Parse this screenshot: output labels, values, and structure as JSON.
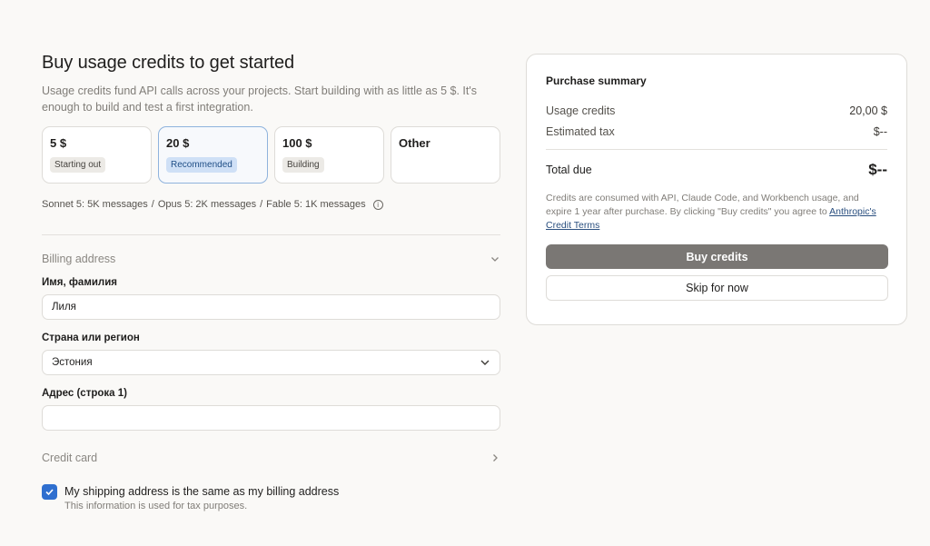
{
  "header": {
    "title": "Buy usage credits to get started",
    "subtitle": "Usage credits fund API calls across your projects. Start building with as little as 5 $. It's enough to build and test a first integration."
  },
  "options": [
    {
      "amount": "5 $",
      "tag": "Starting out",
      "selected": false
    },
    {
      "amount": "20 $",
      "tag": "Recommended",
      "selected": true
    },
    {
      "amount": "100 $",
      "tag": "Building",
      "selected": false
    },
    {
      "amount": "Other",
      "tag": "",
      "selected": false
    }
  ],
  "models_note": {
    "sonnet": "Sonnet 5: 5K messages",
    "opus": "Opus 5: 2K messages",
    "fable": "Fable 5: 1K messages",
    "sep": "/",
    "info_icon": "info-icon"
  },
  "billing": {
    "section_label": "Billing address",
    "name_label": "Имя, фамилия",
    "name_value": "Лиля",
    "country_label": "Страна или регион",
    "country_value": "Эстония",
    "address_label": "Адрес (строка 1)",
    "address_value": ""
  },
  "credit_card": {
    "section_label": "Credit card"
  },
  "shipping": {
    "checked": true,
    "label": "My shipping address is the same as my billing address",
    "sublabel": "This information is used for tax purposes."
  },
  "summary": {
    "title": "Purchase summary",
    "usage_label": "Usage credits",
    "usage_value": "20,00 $",
    "tax_label": "Estimated tax",
    "tax_value": "$--",
    "total_label": "Total due",
    "total_value": "$--",
    "terms_text": "Credits are consumed with API, Claude Code, and Workbench usage, and expire 1 year after purchase. By clicking \"Buy credits\" you agree to",
    "terms_link": "Anthropic's Credit Terms",
    "buy_label": "Buy credits",
    "skip_label": "Skip for now"
  },
  "colors": {
    "accent": "#2f6fcf",
    "selected_border": "#8fb3dd",
    "recommended_badge": "#cfe0f6",
    "buy_button": "#7a7774"
  }
}
